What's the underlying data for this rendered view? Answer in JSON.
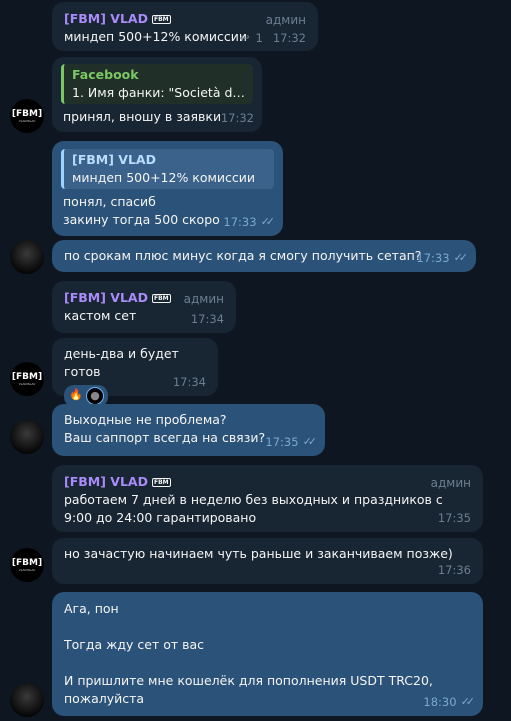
{
  "messages": [
    {
      "sender": "[FBM] VLAD",
      "role": "админ",
      "text": "миндеп 500+12% комиссии",
      "replies": "1",
      "time": "17:32"
    },
    {
      "quote_title": "Facebook",
      "quote_text": "1. Имя фанки: \"Società di tr...",
      "text": "принял, вношу в заявки",
      "time": "17:32"
    },
    {
      "quote_title": "[FBM] VLAD",
      "quote_text": "миндеп 500+12% комиссии",
      "text": "понял, спасиб\nзакину тогда 500 скоро",
      "time": "17:33"
    },
    {
      "text": "по срокам плюс минус когда я смогу получить сетап?",
      "time": "17:33"
    },
    {
      "sender": "[FBM] VLAD",
      "role": "админ",
      "text": "кастом сет",
      "time": "17:34"
    },
    {
      "text": "день-два и будет готов",
      "time": "17:34",
      "reactions": [
        "fire-emoji",
        "user-avatar"
      ]
    },
    {
      "text": "Выходные не проблема?\nВаш саппорт всегда на связи?",
      "time": "17:35"
    },
    {
      "sender": "[FBM] VLAD",
      "role": "админ",
      "text": "работаем 7 дней в неделю без выходных и праздников с 9:00 до 24:00 гарантировано",
      "time": "17:35"
    },
    {
      "text": "но зачастую начинаем чуть раньше и заканчиваем позже)",
      "time": "17:36"
    },
    {
      "text": "Ага, пон\n\nТогда жду сет от вас\n\nИ пришлите мне кошелёк для пополнения USDT TRC20, пожалуйста",
      "time": "18:30"
    }
  ],
  "avatar": {
    "logo": "[FBM]",
    "sub": "VLADISLAV"
  },
  "fbm_tag": "FBM",
  "colors": {
    "background": "#0e1621",
    "incoming": "#182533",
    "outgoing": "#2b5278",
    "name": "#a98bf7"
  }
}
